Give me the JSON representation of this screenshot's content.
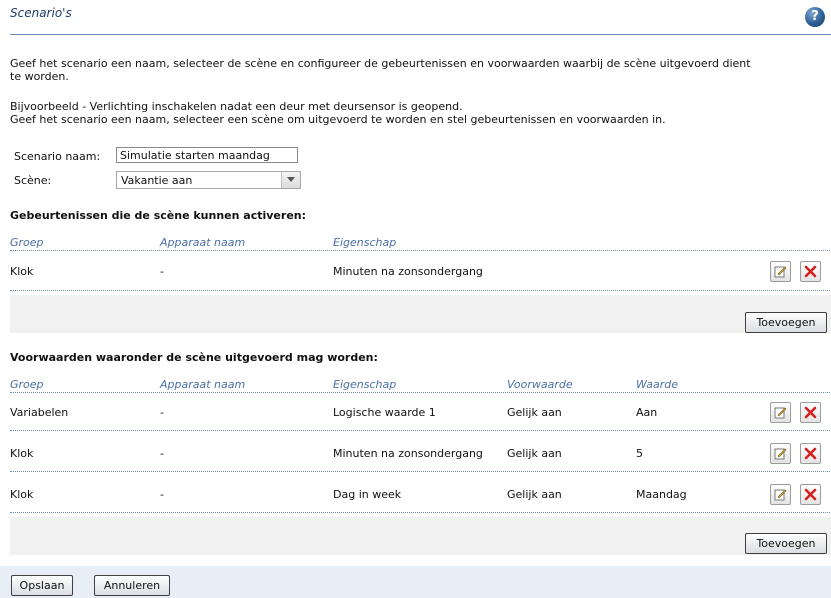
{
  "header": {
    "title": "Scenario's",
    "help_icon": "help-icon",
    "help_glyph": "?"
  },
  "intro": {
    "line1": "Geef het scenario een naam, selecteer de scène en configureer de gebeurtenissen en voorwaarden waarbij de scène uitgevoerd dient",
    "line2": "te worden.",
    "example1": "Bijvoorbeeld - Verlichting inschakelen nadat een deur met deursensor is geopend.",
    "example2": "Geef het scenario een naam, selecteer een scène om uitgevoerd te worden en stel gebeurtenissen en voorwaarden in."
  },
  "form": {
    "name_label": "Scenario naam:",
    "name_value": "Simulatie starten maandag",
    "scene_label": "Scène:",
    "scene_value": "Vakantie aan"
  },
  "events": {
    "title": "Gebeurtenissen die de scène kunnen activeren:",
    "columns": [
      "Groep",
      "Apparaat naam",
      "Eigenschap"
    ],
    "rows": [
      {
        "group": "Klok",
        "device": "-",
        "property": "Minuten na zonsondergang"
      }
    ],
    "add_label": "Toevoegen"
  },
  "conditions": {
    "title": "Voorwaarden waaronder de scène uitgevoerd mag worden:",
    "columns": [
      "Groep",
      "Apparaat naam",
      "Eigenschap",
      "Voorwaarde",
      "Waarde"
    ],
    "rows": [
      {
        "group": "Variabelen",
        "device": "-",
        "property": "Logische waarde 1",
        "condition": "Gelijk aan",
        "value": "Aan"
      },
      {
        "group": "Klok",
        "device": "-",
        "property": "Minuten na zonsondergang",
        "condition": "Gelijk aan",
        "value": "5"
      },
      {
        "group": "Klok",
        "device": "-",
        "property": "Dag in week",
        "condition": "Gelijk aan",
        "value": "Maandag"
      }
    ],
    "add_label": "Toevoegen"
  },
  "footer": {
    "save_label": "Opslaan",
    "cancel_label": "Annuleren"
  },
  "icons": {
    "edit": "edit-icon",
    "delete": "delete-icon",
    "dropdown": "chevron-down-icon"
  },
  "colors": {
    "accent": "#1f3e6b",
    "column_header": "#4a6fa5",
    "delete_red": "#d42020"
  }
}
